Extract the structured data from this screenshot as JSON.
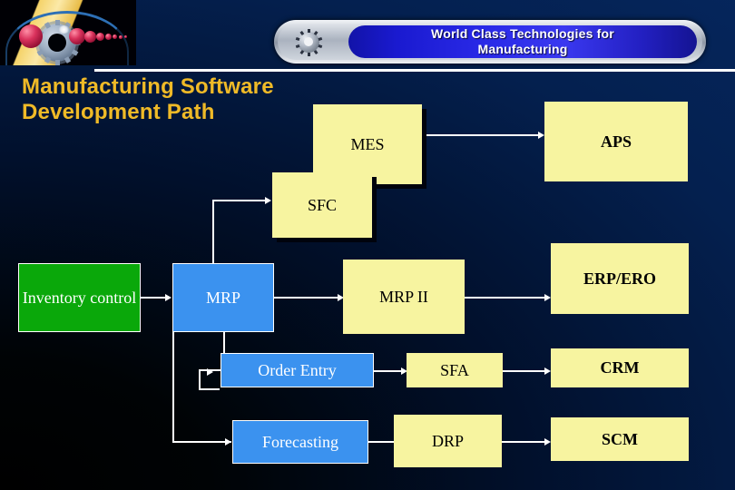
{
  "header": {
    "logo_icon": "eye-gear-logo",
    "banner_gear_icon": "gear-icon",
    "banner_line1": "World Class Technologies for",
    "banner_line2": "Manufacturing"
  },
  "title": {
    "line1": "Manufacturing Software",
    "line2": "Development Path"
  },
  "colors": {
    "title": "#F0BA27",
    "yellow_node": "#F7F4A0",
    "blue_node": "#3B92EF",
    "green_node": "#0AA80A",
    "connector": "#FFFFFF",
    "background_dark": "#000205",
    "background_navy": "#062861",
    "banner_blue": "#2A2AE8"
  },
  "diagram": {
    "nodes": [
      {
        "id": "mes",
        "label": "MES"
      },
      {
        "id": "aps",
        "label": "APS"
      },
      {
        "id": "sfc",
        "label": "SFC"
      },
      {
        "id": "inventory",
        "label": "Inventory control"
      },
      {
        "id": "mrp",
        "label": "MRP"
      },
      {
        "id": "mrp2",
        "label": "MRP II"
      },
      {
        "id": "erp",
        "label": "ERP/ERO"
      },
      {
        "id": "order_entry",
        "label": "Order Entry"
      },
      {
        "id": "sfa",
        "label": "SFA"
      },
      {
        "id": "crm",
        "label": "CRM"
      },
      {
        "id": "forecasting",
        "label": "Forecasting"
      },
      {
        "id": "drp",
        "label": "DRP"
      },
      {
        "id": "scm",
        "label": "SCM"
      }
    ],
    "edges": [
      "mes -> aps",
      "mrp -> sfc",
      "inventory -> mrp",
      "mrp -> mrp2",
      "mrp2 -> erp",
      "mrp -> order_entry",
      "order_entry -> sfa",
      "sfa -> crm",
      "mrp -> forecasting",
      "forecasting -> drp",
      "drp -> scm"
    ]
  }
}
